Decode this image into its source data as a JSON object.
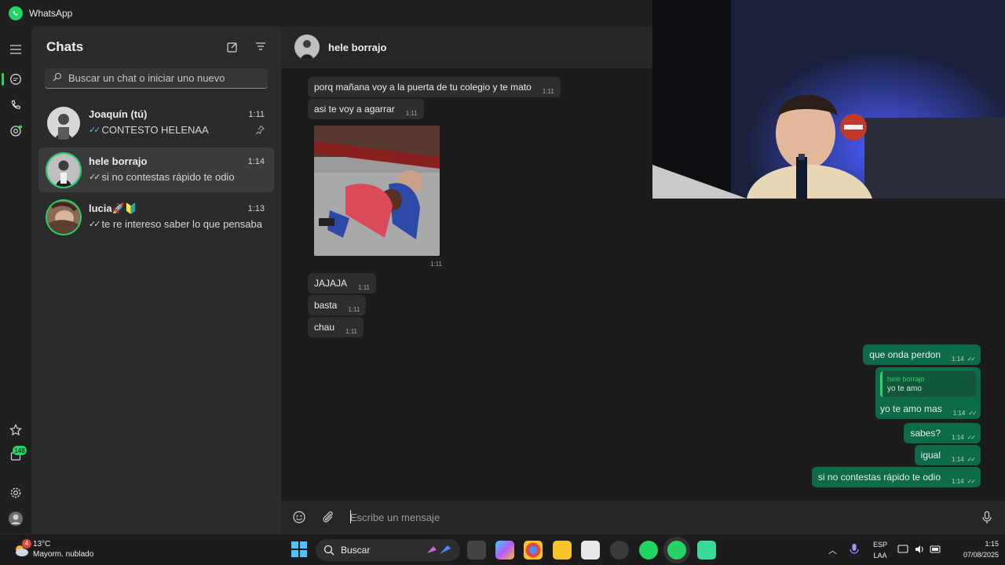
{
  "window": {
    "title": "WhatsApp"
  },
  "rail": {
    "updates_badge": "148"
  },
  "chatlist": {
    "title": "Chats",
    "search_placeholder": "Buscar un chat o iniciar uno nuevo",
    "chats": [
      {
        "name": "Joaquín  (tú)",
        "time": "1:11",
        "preview": "CONTESTO HELENAA",
        "pinned": true
      },
      {
        "name": "hele borrajo",
        "time": "1:14",
        "preview": "si no contestas rápido te odio",
        "selected": true
      },
      {
        "name": "lucia🚀🔰",
        "time": "1:13",
        "preview": "te re intereso saber lo que pensaba"
      }
    ]
  },
  "conversation": {
    "contact_name": "hele borrajo",
    "incoming": [
      {
        "text": "porq mañana voy a la puerta de tu colegio y te mato",
        "time": "1:11"
      },
      {
        "text": "asi te voy a agarrar",
        "time": "1:11"
      },
      {
        "text": "JAJAJA",
        "time": "1:11"
      },
      {
        "text": "basta",
        "time": "1:11"
      },
      {
        "text": "chau",
        "time": "1:11"
      }
    ],
    "image_time": "1:11",
    "outgoing": [
      {
        "text": "que onda perdon",
        "time": "1:14"
      },
      {
        "quote_name": "hele borrajo",
        "quote_text": "yo te amo",
        "text": "yo te amo mas",
        "time": "1:14"
      },
      {
        "text": "sabes?",
        "time": "1:14"
      },
      {
        "text": "igual",
        "time": "1:14"
      },
      {
        "text": "si no contestas rápido te odio",
        "time": "1:14"
      }
    ],
    "composer_placeholder": "Escribe un mensaje"
  },
  "taskbar": {
    "weather_badge": "4",
    "temperature": "13°C",
    "weather": "Mayorm. nublado",
    "search_label": "Buscar",
    "language": "ESP",
    "layout": "LAA",
    "time": "1:15",
    "date": "07/08/2025"
  },
  "colors": {
    "accent": "#25d366",
    "outgoing_bubble": "#0e6b47",
    "incoming_bubble": "#2e2e2e"
  }
}
